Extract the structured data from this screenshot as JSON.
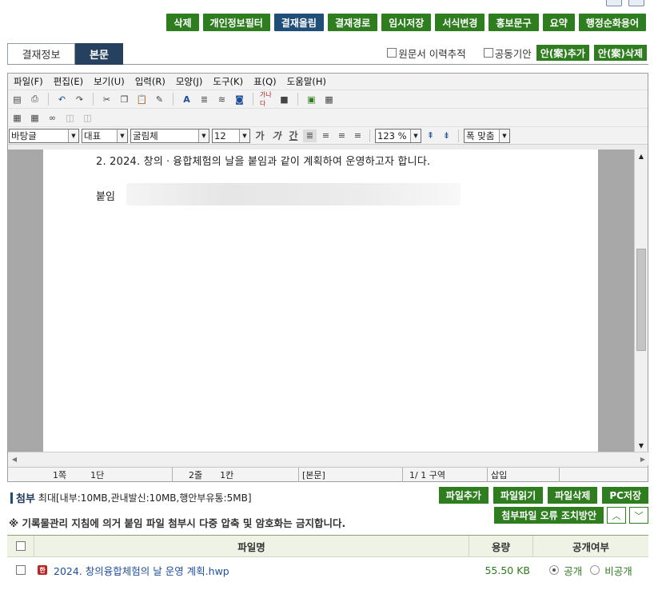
{
  "action_bar": {
    "buttons": [
      "삭제",
      "개인정보필터",
      "결재올림",
      "결재경로",
      "임시저장",
      "서식변경",
      "홍보문구",
      "요약",
      "행정순화용어"
    ]
  },
  "tabs": [
    "결재정보",
    "본문"
  ],
  "tab_options": {
    "trace_label": "원문서 이력추적",
    "joint_label": "공동기안",
    "add_draft": "안(案)추가",
    "del_draft": "안(案)삭제"
  },
  "menu": [
    "파일(F)",
    "편집(E)",
    "보기(U)",
    "입력(R)",
    "모양(J)",
    "도구(K)",
    "표(Q)",
    "도움말(H)"
  ],
  "format": {
    "style": "바탕글",
    "lang": "대표",
    "font": "굴림체",
    "size": "12",
    "zoom": "123 %",
    "fit": "폭 맞춤",
    "bold": "가",
    "italic": "가",
    "underline": "간"
  },
  "document": {
    "line1": "2. 2024. 창의ㆍ융합체험의 날을 붙임과 같이 계획하여 운영하고자 합니다.",
    "line2": "붙임"
  },
  "status": {
    "page": "1쪽",
    "section": "1단",
    "line": "2줄",
    "col": "1칸",
    "area": "[본문]",
    "region": "1/ 1 구역",
    "mode": "삽입"
  },
  "attachment": {
    "title": "첨부",
    "limit": "최대[내부:10MB,관내발신:10MB,행안부유통:5MB]",
    "notice": "※ 기록물관리 지침에 의거 붙임 파일 첨부시 다중 압축 및 암호화는 금지합니다.",
    "buttons": [
      "파일추가",
      "파일읽기",
      "파일삭제",
      "PC저장"
    ],
    "error_button": "첨부파일 오류 조치방안",
    "columns": {
      "name": "파일명",
      "size": "용량",
      "public": "공개여부"
    },
    "files": [
      {
        "name": "2024. 창의융합체험의 날 운영 계획.hwp",
        "size": "55.50 KB",
        "public_label": "공개",
        "private_label": "비공개"
      }
    ]
  }
}
